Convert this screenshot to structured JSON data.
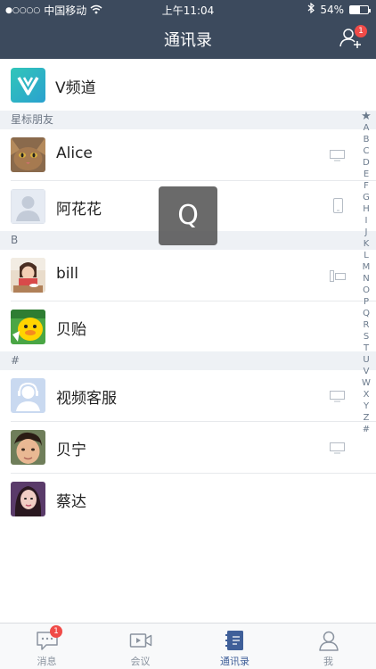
{
  "status_bar": {
    "carrier_dots": "●○○○○",
    "carrier": "中国移动",
    "time": "上午11:04",
    "battery": "54%",
    "battery_level": 0.54,
    "icons": [
      "wifi-icon",
      "bluetooth-icon",
      "battery-icon"
    ]
  },
  "header": {
    "title": "通讯录",
    "add_friend_badge": "1"
  },
  "vchannel": {
    "label": "V频道"
  },
  "sections": {
    "starred": "星标朋友",
    "b": "B",
    "hash": "#"
  },
  "contacts": [
    {
      "name": "Alice",
      "device": "desktop"
    },
    {
      "name": "阿花花",
      "device": "phone"
    },
    {
      "name": "bill",
      "device": "room-system"
    },
    {
      "name": "贝贻",
      "device": ""
    },
    {
      "name": "视频客服",
      "device": "desktop"
    },
    {
      "name": "贝宁",
      "device": "desktop"
    },
    {
      "name": "蔡达",
      "device": ""
    }
  ],
  "index_letters": [
    "★",
    "A",
    "B",
    "C",
    "D",
    "E",
    "F",
    "G",
    "H",
    "I",
    "J",
    "K",
    "L",
    "M",
    "N",
    "O",
    "P",
    "Q",
    "R",
    "S",
    "T",
    "U",
    "V",
    "W",
    "X",
    "Y",
    "Z",
    "#"
  ],
  "overlay_letter": "Q",
  "tabs": [
    {
      "label": "消息",
      "icon": "chat-icon",
      "badge": "1",
      "active": false
    },
    {
      "label": "会议",
      "icon": "video-camera-icon",
      "badge": "",
      "active": false
    },
    {
      "label": "通讯录",
      "icon": "contacts-book-icon",
      "badge": "",
      "active": true
    },
    {
      "label": "我",
      "icon": "person-icon",
      "badge": "",
      "active": false
    }
  ],
  "colors": {
    "header_bg": "#3c4a5d",
    "section_bg": "#eef1f5",
    "badge": "#f04b48",
    "active_tab": "#3f5f99"
  }
}
